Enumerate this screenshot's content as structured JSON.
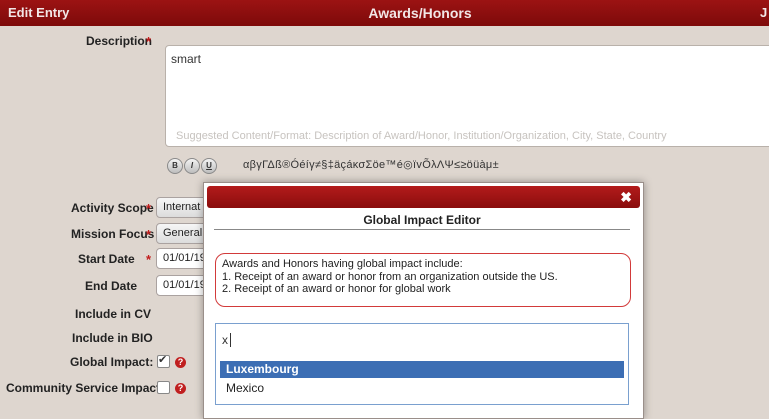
{
  "header": {
    "left_label": "Edit Entry",
    "title": "Awards/Honors",
    "right_fragment": "J"
  },
  "form": {
    "description_label": "Description",
    "required_mark": "*",
    "description_value": "smart",
    "description_hint": "Suggested Content/Format: Description of Award/Honor, Institution/Organization, City, State, Country",
    "format_buttons": [
      "B",
      "I",
      "U"
    ],
    "symbols": "αβγΓΔß®Óéíγ≠§‡äçáκσΣöe™é◎ïvÕλΛΨ≤≥öüàμ±",
    "activity_scope_label": "Activity Scope",
    "activity_scope_value": "Internat",
    "mission_focus_label": "Mission Focus",
    "mission_focus_value": "General",
    "start_date_label": "Start Date",
    "start_date_value": "01/01/19",
    "end_date_label": "End Date",
    "end_date_value": "01/01/19",
    "include_cv_label": "Include in CV",
    "include_bio_label": "Include in BIO",
    "global_impact_label": "Global Impact:",
    "global_impact_checked": true,
    "community_label": "Community Service Impact:",
    "community_checked": false,
    "help_glyph": "?"
  },
  "modal": {
    "close_glyph": "✖",
    "title": "Global Impact Editor",
    "info_lines": [
      "Awards and Honors having global impact include:",
      "1. Receipt of an award or honor from an organization outside the US.",
      "2. Receipt of an award or honor for global work"
    ],
    "input_value": "x",
    "options": [
      "Luxembourg",
      "Mexico"
    ],
    "selected_index": 0
  },
  "colors": {
    "header_red": "#8a0d0d",
    "selection_blue": "#3c6eb4",
    "required_red": "#c21b1b"
  }
}
